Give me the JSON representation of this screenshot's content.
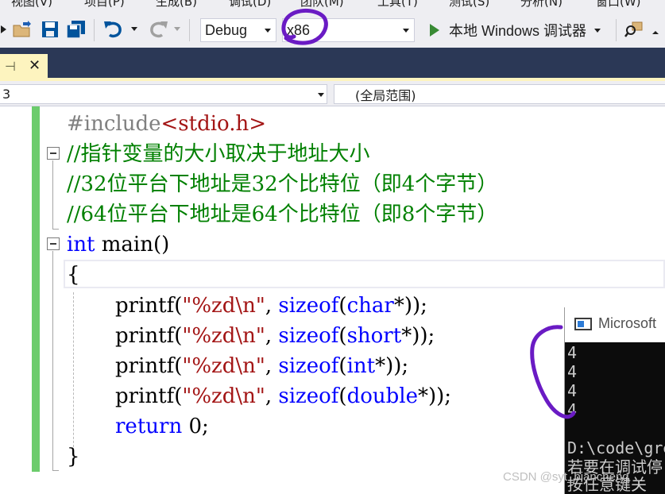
{
  "menu": {
    "items": [
      "视图(V)",
      "项目(P)",
      "生成(B)",
      "调试(D)",
      "团队(M)",
      "工具(T)",
      "测试(S)",
      "分析(N)",
      "窗口(W)"
    ]
  },
  "toolbar": {
    "config": "Debug",
    "platform": "x86",
    "run_label": "本地 Windows 调试器",
    "icons": [
      "open-folder-icon",
      "save-icon",
      "save-all-icon",
      "undo-icon",
      "redo-icon",
      "find-in-files-icon"
    ]
  },
  "tab": {
    "pin_glyph": "⊣",
    "close_glyph": "✕"
  },
  "navbar": {
    "left_scope": "3",
    "right_scope": "(全局范围)"
  },
  "code": {
    "line1": {
      "directive": "#include",
      "header": "<stdio.h>"
    },
    "line2": "//指针变量的大小取决于地址大小",
    "line3": "//32位平台下地址是32个比特位（即4个字节）",
    "line4": "//64位平台下地址是64个比特位（即8个字节）",
    "line5": {
      "kw": "int",
      "rest": " main()"
    },
    "line6": "{",
    "printf_lines": [
      {
        "fn": "printf(",
        "str": "\"%zd\\n\"",
        "mid": ", ",
        "kw": "sizeof",
        "open": "(",
        "type": "char",
        "tail": "*));"
      },
      {
        "fn": "printf(",
        "str": "\"%zd\\n\"",
        "mid": ", ",
        "kw": "sizeof",
        "open": "(",
        "type": "short",
        "tail": "*));"
      },
      {
        "fn": "printf(",
        "str": "\"%zd\\n\"",
        "mid": ", ",
        "kw": "sizeof",
        "open": "(",
        "type": "int",
        "tail": "*));"
      },
      {
        "fn": "printf(",
        "str": "\"%zd\\n\"",
        "mid": ", ",
        "kw": "sizeof",
        "open": "(",
        "type": "double",
        "tail": "*));"
      }
    ],
    "return_line": {
      "kw": "return",
      "rest": " 0;"
    },
    "close_brace": "}"
  },
  "console": {
    "title": "Microsoft",
    "output": [
      "4",
      "4",
      "4",
      "4"
    ],
    "path_line": "D:\\code\\gre",
    "hint_line1": "若要在调试停",
    "hint_line2": "按任意键关"
  },
  "watermark": "CSDN @syt_biancheng",
  "colors": {
    "toolbar_bg": "#eeeef2",
    "tab_strip_bg": "#2b3856",
    "active_tab": "#fdf4bf",
    "change_bar": "#6ccc6c",
    "comment": "#008000",
    "keyword": "#0000ff",
    "string": "#a31515",
    "annotation": "#6a1bc4"
  }
}
